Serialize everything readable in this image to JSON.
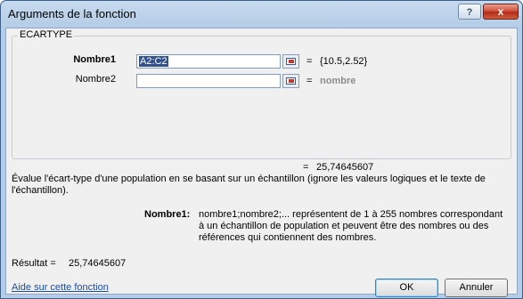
{
  "window": {
    "title": "Arguments de la fonction",
    "help_icon": "?",
    "close_icon": "x"
  },
  "function": {
    "name": "ECARTYPE",
    "args": [
      {
        "label": "Nombre1",
        "value": "A2:C2",
        "result": "{10.5,2.52}"
      },
      {
        "label": "Nombre2",
        "value": "",
        "result": "nombre"
      }
    ],
    "eq_symbol": "=",
    "formula_result": "25,74645607"
  },
  "description": {
    "main": "Évalue l'écart-type d'une population en se basant sur un échantillon (ignore les valeurs logiques et le texte de l'échantillon).",
    "arg_name": "Nombre1:",
    "arg_text": "nombre1;nombre2;... représentent de 1 à 255 nombres correspondant à un échantillon de population et peuvent être des nombres ou des références qui contiennent des nombres."
  },
  "footer": {
    "result_label": "Résultat =",
    "result_value": "25,74645607",
    "help_link": "Aide sur cette fonction",
    "ok_label": "OK",
    "cancel_label": "Annuler"
  }
}
